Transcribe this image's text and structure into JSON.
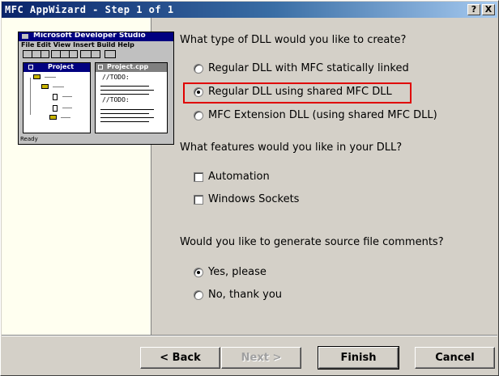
{
  "window": {
    "title": "MFC AppWizard - Step 1 of 1",
    "help_label": "?",
    "close_label": "X"
  },
  "illustration": {
    "app_title": "Microsoft Developer Studio",
    "menu": "File Edit View Insert Build Help",
    "project_title": "Project",
    "file_tab": "Project.cpp",
    "todo_1": "//TODO:",
    "todo_2": "//TODO:",
    "status": "Ready"
  },
  "dll_type": {
    "question": "What type of DLL would you like to create?",
    "options": [
      {
        "label": "Regular DLL with MFC statically linked",
        "selected": false
      },
      {
        "label": "Regular DLL using shared MFC DLL",
        "selected": true
      },
      {
        "label": "MFC Extension DLL (using shared MFC DLL)",
        "selected": false
      }
    ]
  },
  "features": {
    "question": "What features would you like in your DLL?",
    "options": [
      {
        "label": "Automation",
        "checked": false
      },
      {
        "label": "Windows Sockets",
        "checked": false
      }
    ]
  },
  "comments": {
    "question": "Would you like to generate source file comments?",
    "options": [
      {
        "label": "Yes, please",
        "selected": true
      },
      {
        "label": "No, thank you",
        "selected": false
      }
    ]
  },
  "buttons": {
    "back": "< Back",
    "next": "Next >",
    "finish": "Finish",
    "cancel": "Cancel"
  },
  "colors": {
    "highlight": "#e00000",
    "titlebar": "#0a246a",
    "panel": "#fffff0"
  }
}
